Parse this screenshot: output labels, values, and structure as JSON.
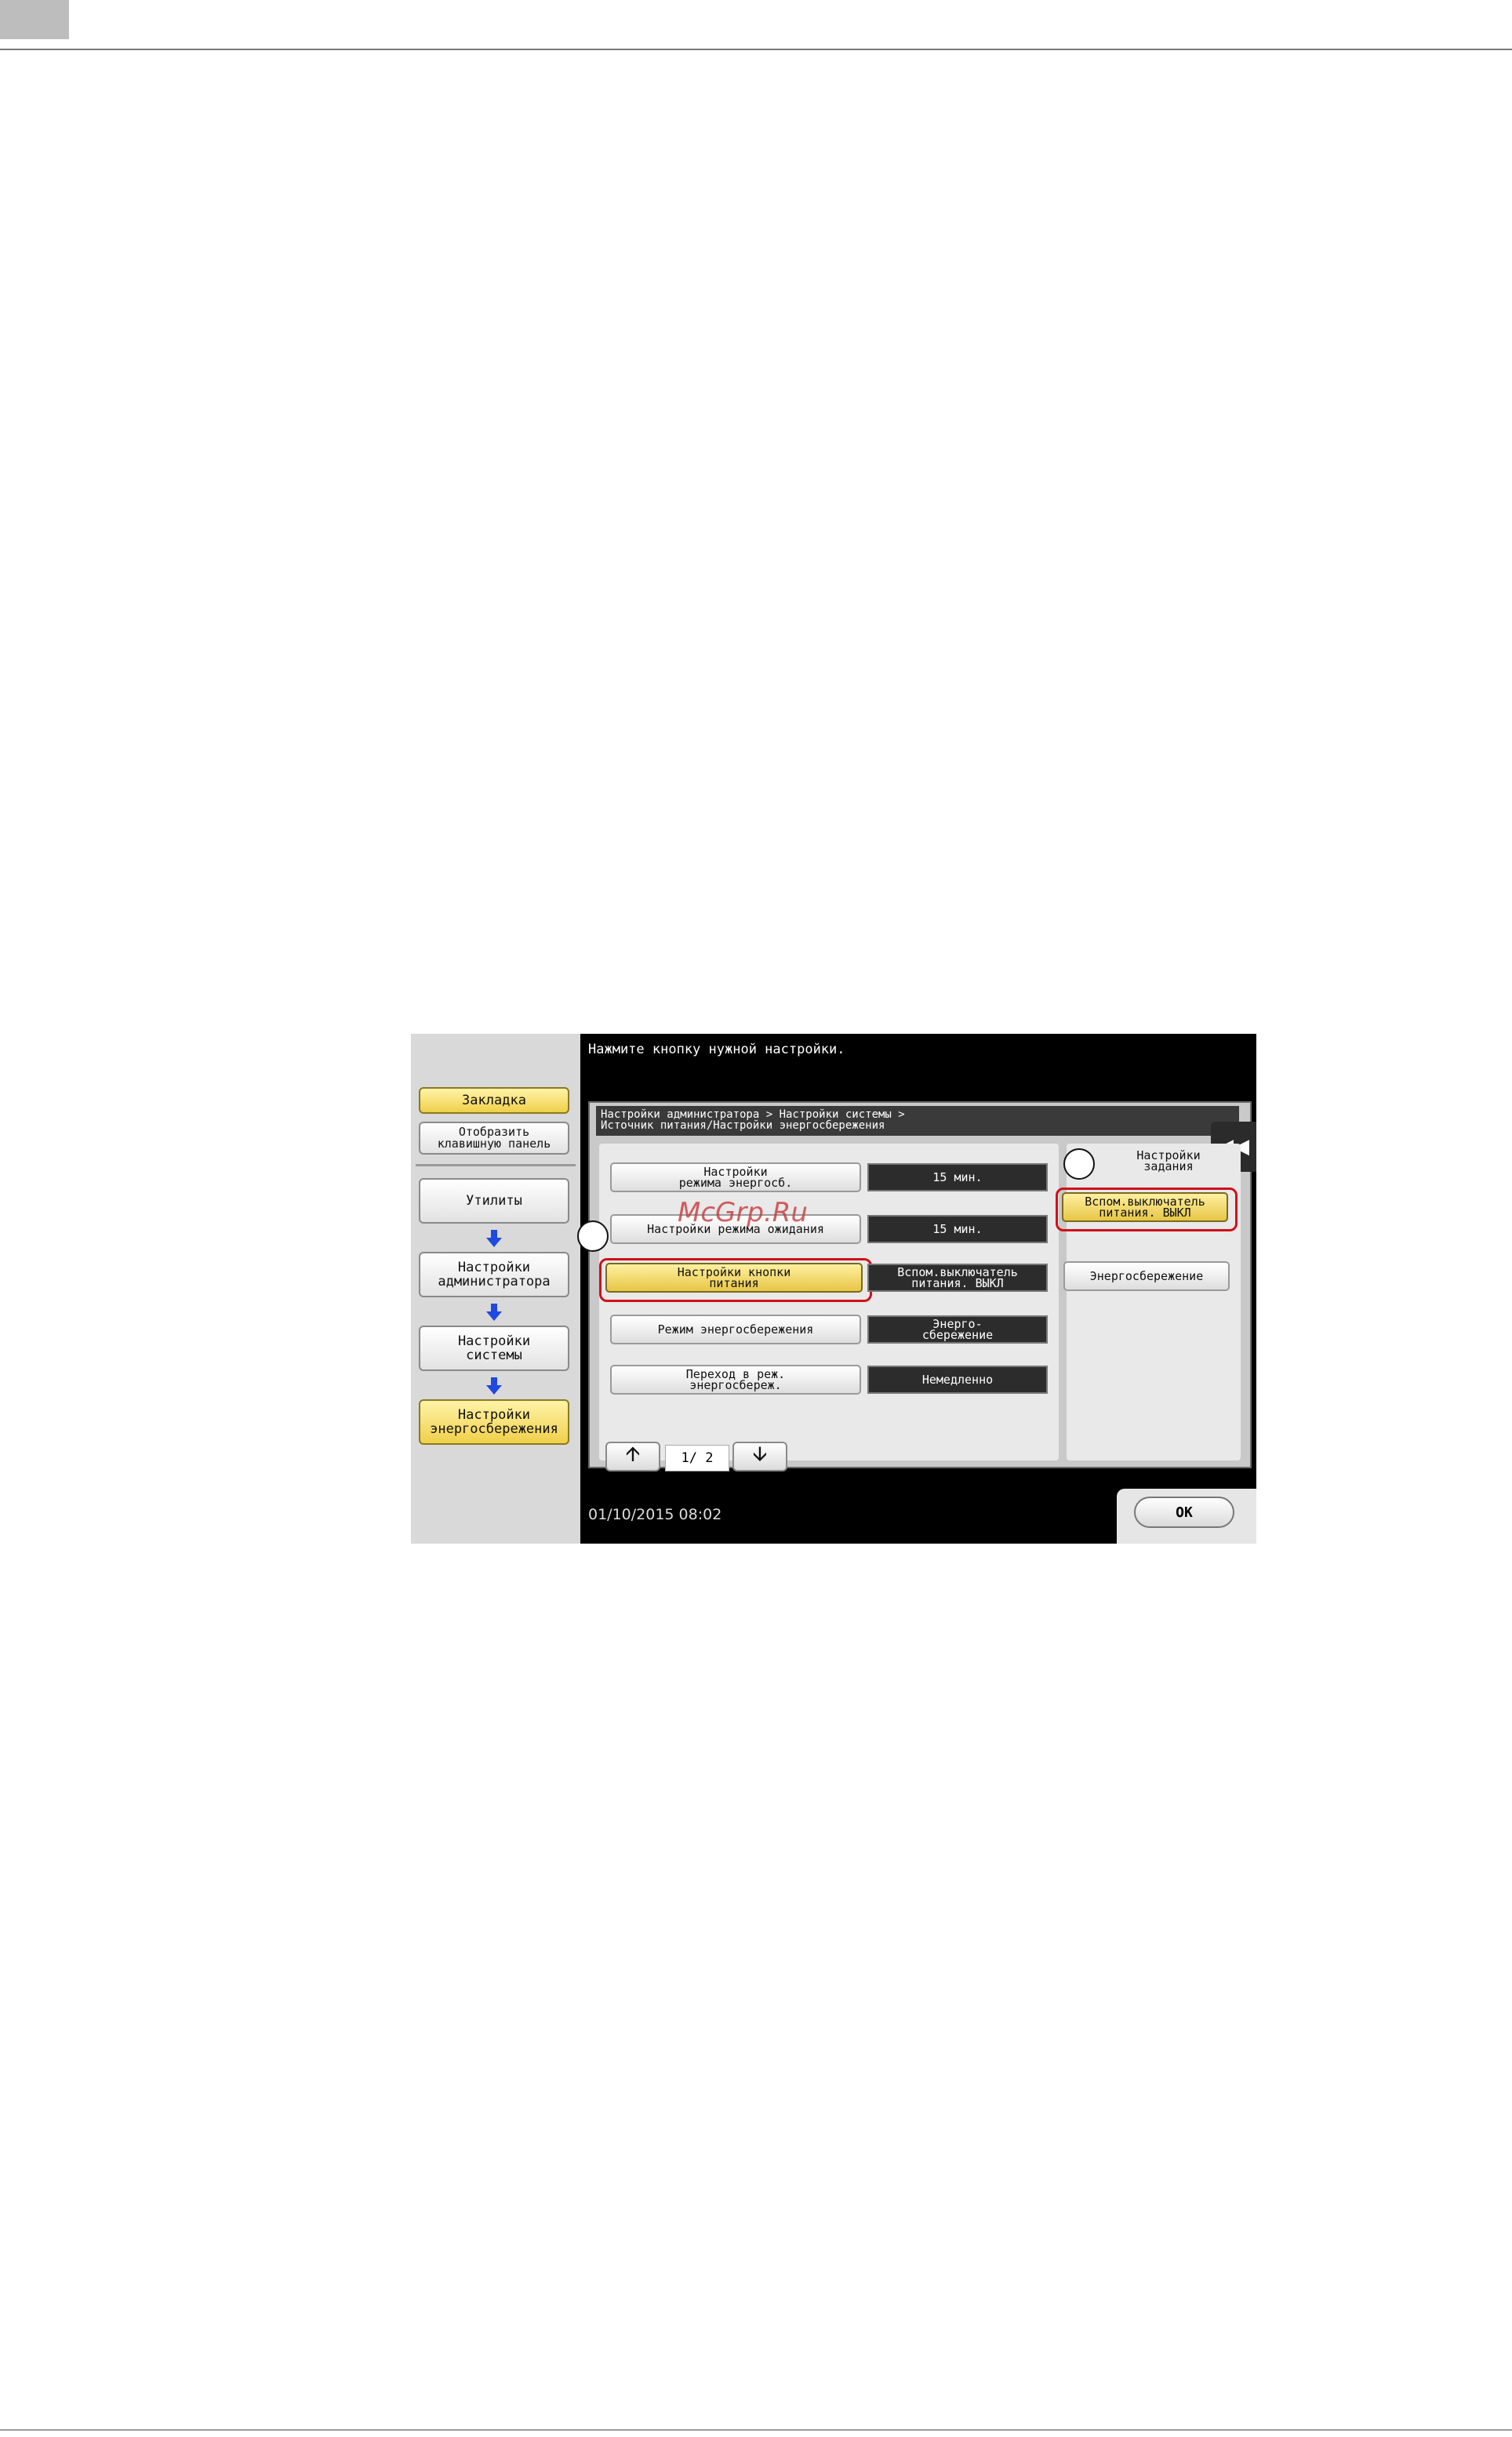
{
  "prompt": "Нажмите кнопку нужной настройки.",
  "breadcrumb": "Настройки администратора > Настройки системы >\nИсточник питания/Настройки энергосбережения",
  "left_nav": {
    "bookmark": "Закладка",
    "show_keypad": "Отобразить\nклавишную панель",
    "utilities": "Утилиты",
    "admin_settings": "Настройки\nадминистратора",
    "system_settings": "Настройки\nсистемы",
    "power_save_settings": "Настройки\nэнергосбережения"
  },
  "settings": [
    {
      "label": "Настройки\nрежима энергосб.",
      "value": "15 мин."
    },
    {
      "label": "Настройки режима ожидания",
      "value": "15 мин."
    },
    {
      "label": "Настройки кнопки\nпитания",
      "value": "Вспом.выключатель\nпитания. ВЫКЛ"
    },
    {
      "label": "Режим энергосбережения",
      "value": "Энерго-\nсбережение"
    },
    {
      "label": "Переход в реж.\nэнергосбереж.",
      "value": "Немедленно"
    }
  ],
  "pager": {
    "label": "1/ 2"
  },
  "side_panel": {
    "title": "Настройки\nзадания",
    "option_1": "Вспом.выключатель\nпитания. ВЫКЛ",
    "option_2": "Энергосбережение"
  },
  "status": {
    "datetime": "01/10/2015   08:02"
  },
  "ok_label": "OK",
  "watermark": "McGrp.Ru",
  "colors": {
    "highlight": "#d0101a",
    "active": "#f0d04a",
    "nav_arrow": "#1f49e0"
  }
}
